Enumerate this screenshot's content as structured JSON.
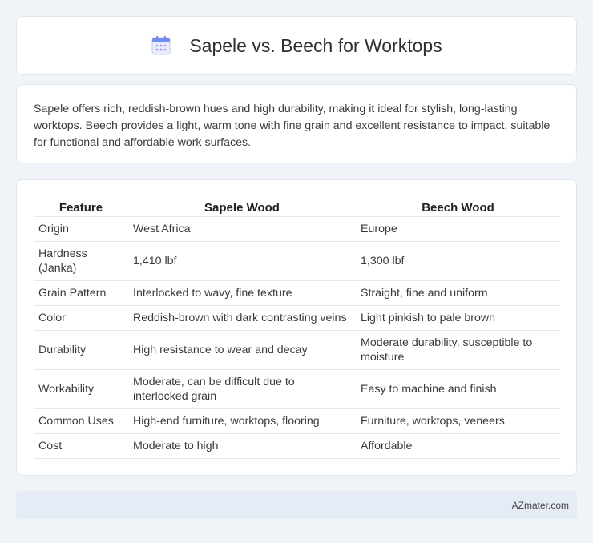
{
  "header": {
    "icon": "calendar-icon",
    "title": "Sapele vs. Beech for Worktops"
  },
  "intro": {
    "text": "Sapele offers rich, reddish-brown hues and high durability, making it ideal for stylish, long-lasting worktops. Beech provides a light, warm tone with fine grain and excellent resistance to impact, suitable for functional and affordable work surfaces."
  },
  "table": {
    "headers": [
      "Feature",
      "Sapele Wood",
      "Beech Wood"
    ],
    "rows": [
      [
        "Origin",
        "West Africa",
        "Europe"
      ],
      [
        "Hardness (Janka)",
        "1,410 lbf",
        "1,300 lbf"
      ],
      [
        "Grain Pattern",
        "Interlocked to wavy, fine texture",
        "Straight, fine and uniform"
      ],
      [
        "Color",
        "Reddish-brown with dark contrasting veins",
        "Light pinkish to pale brown"
      ],
      [
        "Durability",
        "High resistance to wear and decay",
        "Moderate durability, susceptible to moisture"
      ],
      [
        "Workability",
        "Moderate, can be difficult due to interlocked grain",
        "Easy to machine and finish"
      ],
      [
        "Common Uses",
        "High-end furniture, worktops, flooring",
        "Furniture, worktops, veneers"
      ],
      [
        "Cost",
        "Moderate to high",
        "Affordable"
      ]
    ]
  },
  "footer": {
    "site": "AZmater.com"
  },
  "colors": {
    "background": "#f0f3f8",
    "card": "#ffffff",
    "footer": "#e5ecf6",
    "icon_blue": "#5b8def",
    "icon_purple": "#9b8fe0"
  }
}
